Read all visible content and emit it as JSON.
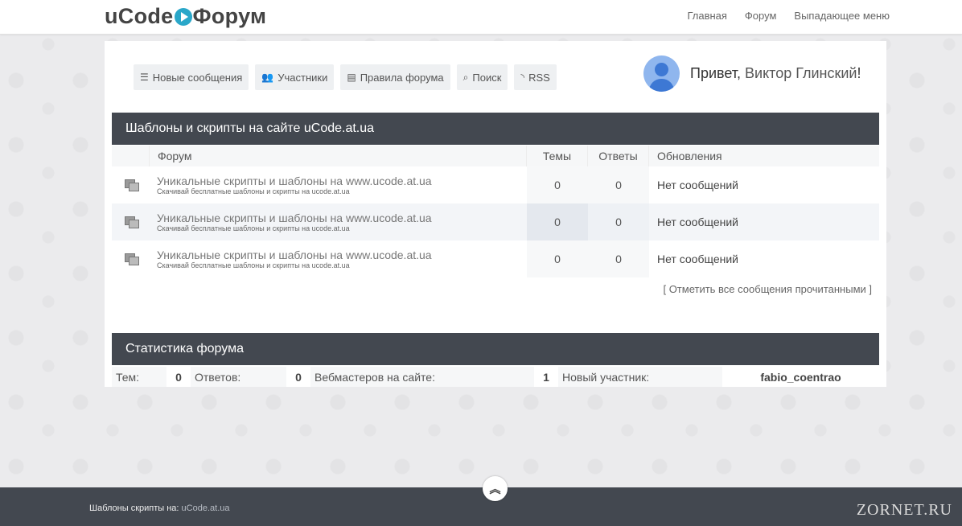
{
  "logo": {
    "part1": "uCode",
    "part2": "Форум"
  },
  "nav": {
    "home": "Главная",
    "forum": "Форум",
    "dropdown": "Выпадающее меню"
  },
  "toolbar": {
    "new_messages": "Новые сообщения",
    "members": "Участники",
    "rules": "Правила форума",
    "search": "Поиск",
    "rss": "RSS"
  },
  "greeting": {
    "prefix": "Привет,",
    "name": "Виктор Глинский",
    "suffix": "!"
  },
  "section1": {
    "title": "Шаблоны и скрипты на сайте uCode.at.ua",
    "columns": {
      "forum": "Форум",
      "themes": "Темы",
      "answers": "Ответы",
      "updates": "Обновления"
    },
    "rows": [
      {
        "title": "Уникальные скрипты и шаблоны на www.ucode.at.ua",
        "desc": "Скачивай бесплатные шаблоны и скрипты на ucode.at.ua",
        "themes": "0",
        "answers": "0",
        "updates": "Нет сообщений"
      },
      {
        "title": "Уникальные скрипты и шаблоны на www.ucode.at.ua",
        "desc": "Скачивай бесплатные шаблоны и скрипты на ucode.at.ua",
        "themes": "0",
        "answers": "0",
        "updates": "Нет сообщений"
      },
      {
        "title": "Уникальные скрипты и шаблоны на www.ucode.at.ua",
        "desc": "Скачивай бесплатные шаблоны и скрипты на ucode.at.ua",
        "themes": "0",
        "answers": "0",
        "updates": "Нет сообщений"
      }
    ],
    "mark_read": "[ Отметить все сообщения прочитанными ]"
  },
  "stats": {
    "title": "Статистика форума",
    "themes_label": "Тем:",
    "themes_value": "0",
    "answers_label": "Ответов:",
    "answers_value": "0",
    "online_label": "Вебмастеров на сайте:",
    "online_value": "1",
    "new_member_label": "Новый участник:",
    "new_member_value": "fabio_coentrao"
  },
  "footer": {
    "text": "Шаблоны скрипты на:",
    "link": "uCode.at.ua"
  },
  "watermark": "ZORNET.RU",
  "icons": {
    "totop": "double-chevron-up-icon"
  }
}
